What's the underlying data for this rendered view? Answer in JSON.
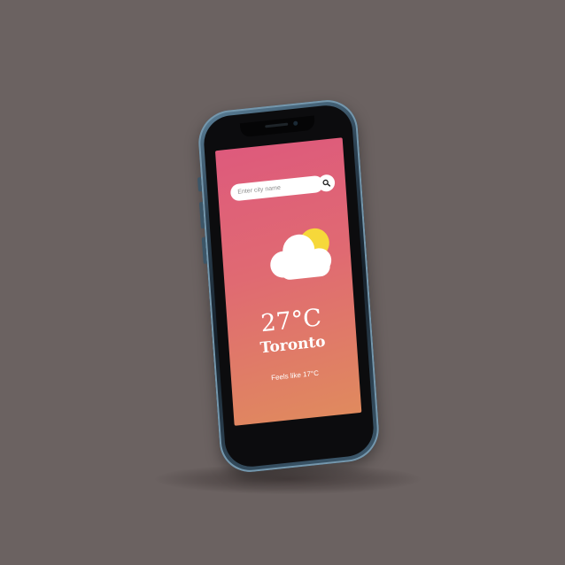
{
  "search": {
    "placeholder": "Enter city name",
    "value": ""
  },
  "weather": {
    "temperature": "27°C",
    "city": "Toronto",
    "feels_like": "Feels like 17°C",
    "icon": "partly-cloudy-icon"
  },
  "icons": {
    "search": "search-icon",
    "weather": "partly-cloudy-icon"
  },
  "colors": {
    "gradient_top": "#de5a7c",
    "gradient_bottom": "#e08a5e",
    "sun": "#f6d83a",
    "cloud": "#ffffff",
    "background": "#6b6261"
  }
}
